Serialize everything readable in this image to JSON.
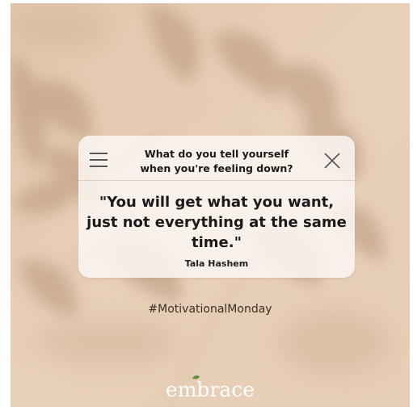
{
  "card": {
    "question_line1": "What do you tell yourself",
    "question_line2": "when you're feeling down?",
    "quote_line1": "\"You will get what you want,",
    "quote_line2": "just not everything at the same",
    "quote_line3": "time.\"",
    "author": "Tala Hashem",
    "menu_icon": "menu-icon",
    "close_icon": "close-icon"
  },
  "hashtag": "#MotivationalMonday",
  "brand": {
    "logo_text": "embrace",
    "logo_accent_color": "#5f8f3a"
  },
  "colors": {
    "background": "#e6cdb4",
    "shadow": "#bd9b7e",
    "card": "#faf6f2",
    "text": "#1a1a1a",
    "logo": "#ffffff"
  }
}
